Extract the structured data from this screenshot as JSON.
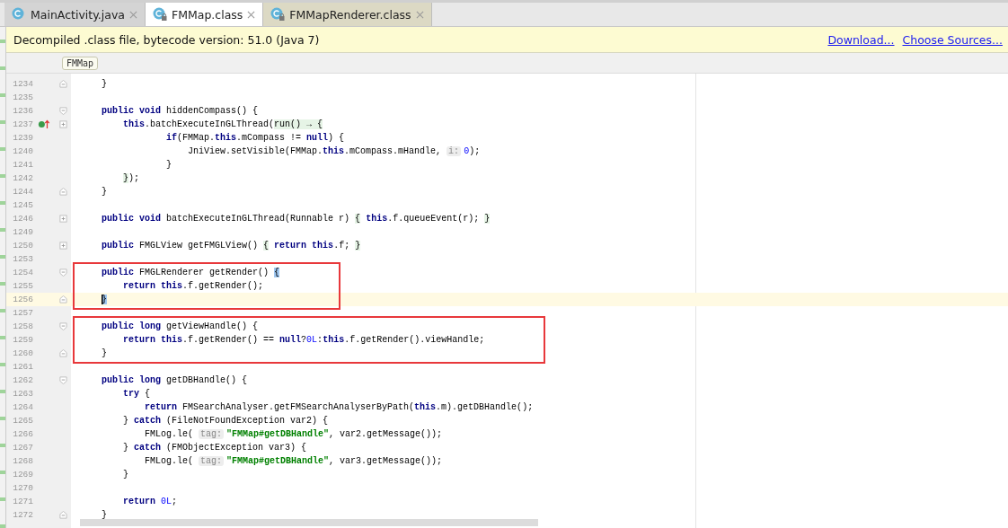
{
  "tabs": [
    {
      "label": "MainActivity.java",
      "kind": "source",
      "selected": false
    },
    {
      "label": "FMMap.class",
      "kind": "compiled",
      "selected": true
    },
    {
      "label": "FMMapRenderer.class",
      "kind": "compiled",
      "selected": false
    }
  ],
  "notice": {
    "message": "Decompiled .class file, bytecode version: 51.0 (Java 7)",
    "links": [
      "Download...",
      "Choose Sources..."
    ]
  },
  "breadcrumb": "FMMap",
  "code_blocks": [
    {
      "boxed": false,
      "lines": [
        {
          "number": "1234",
          "kind": "fold_end",
          "overrides": false,
          "current": false,
          "tokens": [
            {
              "kind": "text",
              "text": "    }"
            }
          ]
        },
        {
          "number": "1235",
          "kind": "plain",
          "overrides": false,
          "current": false
        },
        {
          "number": "1236",
          "kind": "fold_start",
          "overrides": false,
          "current": false,
          "tokens": [
            {
              "kind": "kw",
              "text": "    public void"
            },
            {
              "kind": "text",
              "text": " hiddenCompass() {"
            }
          ]
        },
        {
          "number": "1237",
          "kind": "collapsed",
          "overrides": true,
          "current": false,
          "tokens": [
            {
              "kind": "kw",
              "text": "        this"
            },
            {
              "kind": "text",
              "text": ".batchExecuteInGLThread("
            },
            {
              "kind": "fold",
              "text": "run() → {"
            }
          ]
        },
        {
          "number": "1239",
          "kind": "plain",
          "overrides": false,
          "current": false,
          "tokens": [
            {
              "kind": "kw",
              "text": "                if"
            },
            {
              "kind": "text",
              "text": "(FMMap."
            },
            {
              "kind": "kw",
              "text": "this"
            },
            {
              "kind": "text",
              "text": ".mCompass != "
            },
            {
              "kind": "kw",
              "text": "null"
            },
            {
              "kind": "text",
              "text": ") {"
            }
          ]
        },
        {
          "number": "1240",
          "kind": "plain",
          "overrides": false,
          "current": false,
          "tokens": [
            {
              "kind": "text",
              "text": "                    JniView.setVisible(FMMap."
            },
            {
              "kind": "kw",
              "text": "this"
            },
            {
              "kind": "text",
              "text": ".mCompass.mHandle, "
            },
            {
              "kind": "hint",
              "text": "i:"
            },
            {
              "kind": "num",
              "text": "0"
            },
            {
              "kind": "text",
              "text": ");"
            }
          ]
        },
        {
          "number": "1241",
          "kind": "plain",
          "overrides": false,
          "current": false,
          "tokens": [
            {
              "kind": "text",
              "text": "                }"
            }
          ]
        },
        {
          "number": "1242",
          "kind": "plain",
          "overrides": false,
          "current": false,
          "tokens": [
            {
              "kind": "fold",
              "text": "        }"
            },
            {
              "kind": "text",
              "text": ");"
            }
          ]
        },
        {
          "number": "1244",
          "kind": "fold_end",
          "overrides": false,
          "current": false,
          "tokens": [
            {
              "kind": "text",
              "text": "    }"
            }
          ]
        },
        {
          "number": "1245",
          "kind": "plain",
          "overrides": false,
          "current": false
        },
        {
          "number": "1246",
          "kind": "collapsed",
          "overrides": false,
          "current": false,
          "tokens": [
            {
              "kind": "kw",
              "text": "    public void"
            },
            {
              "kind": "text",
              "text": " batchExecuteInGLThread(Runnable r) "
            },
            {
              "kind": "fold",
              "text": "{"
            },
            {
              "kind": "kw",
              "text": " this"
            },
            {
              "kind": "text",
              "text": ".f.queueEvent(r);"
            },
            {
              "kind": "fold",
              "text": " }"
            }
          ]
        },
        {
          "number": "1249",
          "kind": "plain",
          "overrides": false,
          "current": false
        },
        {
          "number": "1250",
          "kind": "collapsed",
          "overrides": false,
          "current": false,
          "tokens": [
            {
              "kind": "kw",
              "text": "    public"
            },
            {
              "kind": "text",
              "text": " FMGLView getFMGLView() "
            },
            {
              "kind": "fold",
              "text": "{"
            },
            {
              "kind": "kw",
              "text": " return this"
            },
            {
              "kind": "text",
              "text": ".f;"
            },
            {
              "kind": "fold",
              "text": " }"
            }
          ]
        },
        {
          "number": "1253",
          "kind": "plain",
          "overrides": false,
          "current": false
        }
      ]
    },
    {
      "boxed": true,
      "lines": [
        {
          "number": "1254",
          "kind": "fold_start",
          "overrides": false,
          "current": false,
          "tokens": [
            {
              "kind": "kw",
              "text": "    public"
            },
            {
              "kind": "text",
              "text": " FMGLRenderer getRender() "
            },
            {
              "kind": "match",
              "text": "{"
            }
          ]
        },
        {
          "number": "1255",
          "kind": "plain",
          "overrides": false,
          "current": false,
          "tokens": [
            {
              "kind": "kw",
              "text": "        return this"
            },
            {
              "kind": "text",
              "text": ".f.getRender();"
            }
          ]
        },
        {
          "number": "1256",
          "kind": "fold_end",
          "overrides": false,
          "current": true,
          "tokens": [
            {
              "kind": "match",
              "text": "    }"
            }
          ]
        }
      ]
    },
    {
      "boxed": false,
      "lines": [
        {
          "number": "1257",
          "kind": "plain",
          "overrides": false,
          "current": false
        }
      ]
    },
    {
      "boxed": true,
      "lines": [
        {
          "number": "1258",
          "kind": "fold_start",
          "overrides": false,
          "current": false,
          "tokens": [
            {
              "kind": "kw",
              "text": "    public long"
            },
            {
              "kind": "text",
              "text": " getViewHandle() {"
            }
          ]
        },
        {
          "number": "1259",
          "kind": "plain",
          "overrides": false,
          "current": false,
          "tokens": [
            {
              "kind": "kw",
              "text": "        return this"
            },
            {
              "kind": "text",
              "text": ".f.getRender() == "
            },
            {
              "kind": "kw",
              "text": "null"
            },
            {
              "kind": "text",
              "text": "?"
            },
            {
              "kind": "num",
              "text": "0L"
            },
            {
              "kind": "text",
              "text": ":"
            },
            {
              "kind": "kw",
              "text": "this"
            },
            {
              "kind": "text",
              "text": ".f.getRender().viewHandle;"
            }
          ]
        },
        {
          "number": "1260",
          "kind": "fold_end",
          "overrides": false,
          "current": false,
          "tokens": [
            {
              "kind": "text",
              "text": "    }"
            }
          ]
        }
      ]
    },
    {
      "boxed": false,
      "lines": [
        {
          "number": "1261",
          "kind": "plain",
          "overrides": false,
          "current": false
        },
        {
          "number": "1262",
          "kind": "fold_start",
          "overrides": false,
          "current": false,
          "tokens": [
            {
              "kind": "kw",
              "text": "    public long"
            },
            {
              "kind": "text",
              "text": " getDBHandle() {"
            }
          ]
        },
        {
          "number": "1263",
          "kind": "plain",
          "overrides": false,
          "current": false,
          "tokens": [
            {
              "kind": "kw",
              "text": "        try"
            },
            {
              "kind": "text",
              "text": " {"
            }
          ]
        },
        {
          "number": "1264",
          "kind": "plain",
          "overrides": false,
          "current": false,
          "tokens": [
            {
              "kind": "kw",
              "text": "            return"
            },
            {
              "kind": "text",
              "text": " FMSearchAnalyser.getFMSearchAnalyserByPath("
            },
            {
              "kind": "kw",
              "text": "this"
            },
            {
              "kind": "text",
              "text": ".m).getDBHandle();"
            }
          ]
        },
        {
          "number": "1265",
          "kind": "plain",
          "overrides": false,
          "current": false,
          "tokens": [
            {
              "kind": "text",
              "text": "        } "
            },
            {
              "kind": "kw",
              "text": "catch"
            },
            {
              "kind": "text",
              "text": " (FileNotFoundException var2) {"
            }
          ]
        },
        {
          "number": "1266",
          "kind": "plain",
          "overrides": false,
          "current": false,
          "tokens": [
            {
              "kind": "text",
              "text": "            FMLog.le( "
            },
            {
              "kind": "hint",
              "text": "tag:"
            },
            {
              "kind": "str",
              "text": "\"FMMap#getDBHandle\""
            },
            {
              "kind": "text",
              "text": ", var2.getMessage());"
            }
          ]
        },
        {
          "number": "1267",
          "kind": "plain",
          "overrides": false,
          "current": false,
          "tokens": [
            {
              "kind": "text",
              "text": "        } "
            },
            {
              "kind": "kw",
              "text": "catch"
            },
            {
              "kind": "text",
              "text": " (FMObjectException var3) {"
            }
          ]
        },
        {
          "number": "1268",
          "kind": "plain",
          "overrides": false,
          "current": false,
          "tokens": [
            {
              "kind": "text",
              "text": "            FMLog.le( "
            },
            {
              "kind": "hint",
              "text": "tag:"
            },
            {
              "kind": "str",
              "text": "\"FMMap#getDBHandle\""
            },
            {
              "kind": "text",
              "text": ", var3.getMessage());"
            }
          ]
        },
        {
          "number": "1269",
          "kind": "plain",
          "overrides": false,
          "current": false,
          "tokens": [
            {
              "kind": "text",
              "text": "        }"
            }
          ]
        },
        {
          "number": "1270",
          "kind": "plain",
          "overrides": false,
          "current": false
        },
        {
          "number": "1271",
          "kind": "plain",
          "overrides": false,
          "current": false,
          "tokens": [
            {
              "kind": "kw",
              "text": "        return"
            },
            {
              "kind": "num",
              "text": " 0L"
            },
            {
              "kind": "text",
              "text": ";"
            }
          ]
        },
        {
          "number": "1272",
          "kind": "fold_end",
          "overrides": false,
          "current": false,
          "tokens": [
            {
              "kind": "text",
              "text": "    }"
            }
          ]
        }
      ]
    }
  ]
}
